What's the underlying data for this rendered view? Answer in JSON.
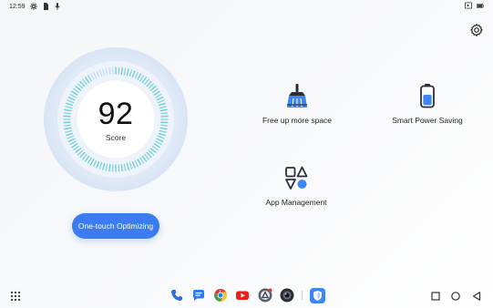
{
  "status_bar": {
    "time": "12:59",
    "left_icons": [
      "settings-icon",
      "sim-icon",
      "mic-icon"
    ],
    "right_icons": [
      "cast-icon",
      "battery-icon"
    ]
  },
  "header": {
    "settings_icon": "gear-icon"
  },
  "score": {
    "value": "92",
    "label": "Score",
    "fraction": 0.92
  },
  "optimize_button": {
    "label": "One-touch Optimizing"
  },
  "features": [
    {
      "label": "Free up more space",
      "icon": "broom-icon"
    },
    {
      "label": "Smart Power Saving",
      "icon": "battery-saver-icon"
    },
    {
      "label": "App Management",
      "icon": "apps-grid-icon"
    }
  ],
  "taskbar": {
    "apps": [
      "phone-icon",
      "messages-icon",
      "chrome-icon",
      "youtube-icon",
      "assistant-icon",
      "camera-icon",
      "phone-manager-icon"
    ],
    "nav": [
      "recents-icon",
      "home-icon",
      "back-icon"
    ]
  },
  "colors": {
    "accent": "#3b7cf0",
    "ring_teal": "#5fc9cf",
    "ring_blue": "#a9c7f2"
  }
}
